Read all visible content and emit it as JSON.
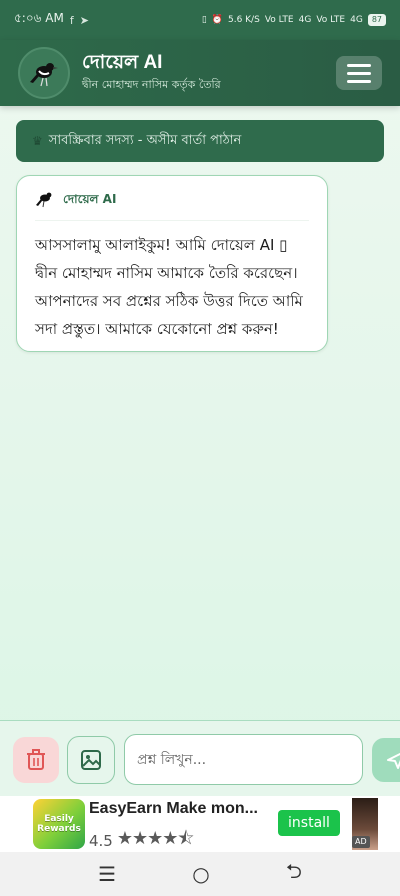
{
  "status_bar": {
    "time": "৫:০৬ AM",
    "net_speed": "5.6 K/S",
    "sim1": "Vo LTE",
    "sim1_signal": "4G",
    "sim2": "Vo LTE",
    "sim2_signal": "4G",
    "battery": "87"
  },
  "header": {
    "title": "দোয়েল AI",
    "subtitle": "দ্বীন মোহাম্মদ নাসিম কর্তৃক তৈরি",
    "logo_icon": "magpie-robin-bird-icon",
    "menu_icon": "hamburger-menu-icon"
  },
  "subscriber_banner": {
    "text": "সাবস্ক্রিবার সদস্য - অসীম বার্তা পাঠান"
  },
  "chat": {
    "messages": [
      {
        "sender": "দোয়েল AI",
        "text": "আসসালামু আলাইকুম! আমি দোয়েল AI ▯ দ্বীন মোহাম্মদ নাসিম আমাকে তৈরি করেছেন। আপনাদের সব প্রশ্নের সঠিক উত্তর দিতে আমি সদা প্রস্তুত। আমাকে যেকোনো প্রশ্ন করুন!"
      }
    ]
  },
  "input_bar": {
    "placeholder": "প্রশ্ন লিখুন...",
    "value": ""
  },
  "ad": {
    "thumb_text": "Easily Rewards",
    "title": "EasyEarn Make mon...",
    "rating": "4.5",
    "install_label": "install",
    "badge": "AD"
  },
  "colors": {
    "primary": "#2e6a4a",
    "bubble_border": "#9fd6b4",
    "delete": "#f9d7d7",
    "install": "#1bc34b"
  }
}
